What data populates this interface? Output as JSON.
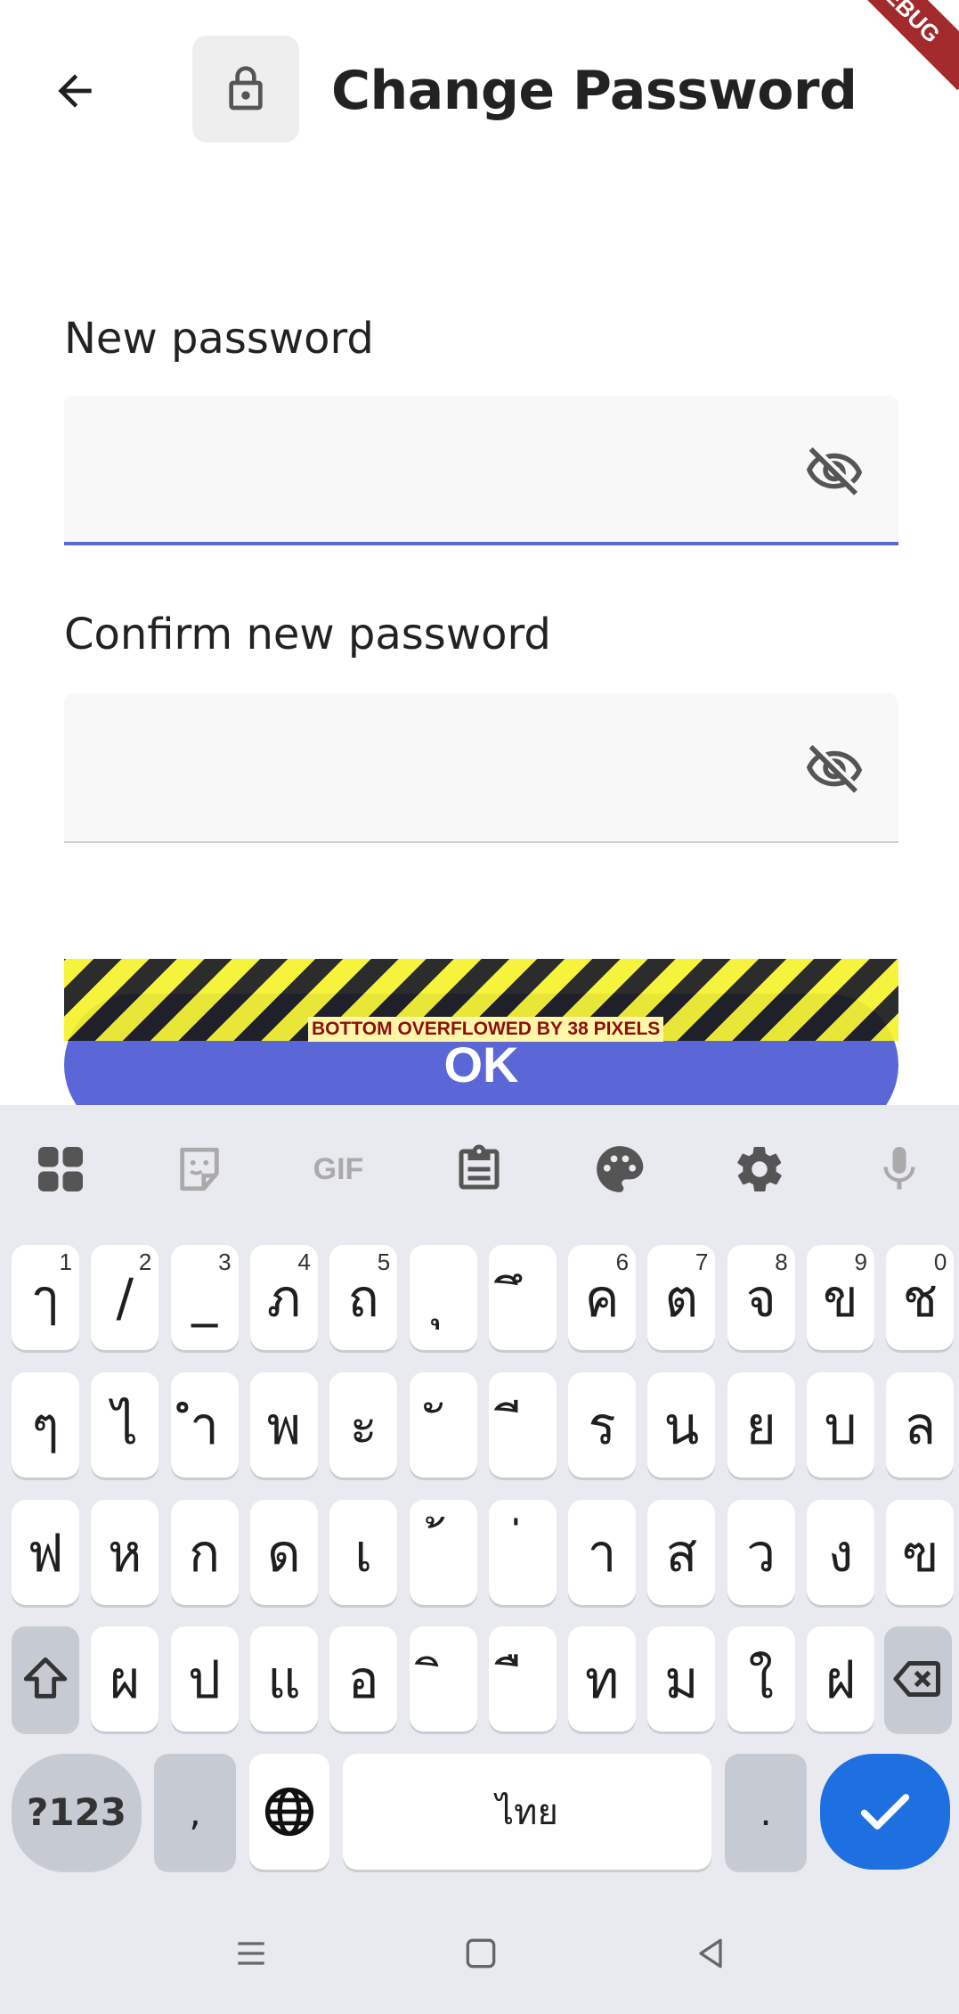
{
  "app_bar": {
    "title": "Change Password",
    "back_icon": "arrow-left-icon",
    "lock_icon": "lock-icon",
    "debug_banner": "DEBUG"
  },
  "form": {
    "new_password": {
      "label": "New password",
      "value": "",
      "visibility_icon": "eye-off-icon",
      "focused": true
    },
    "confirm_password": {
      "label": "Confirm new password",
      "value": "",
      "visibility_icon": "eye-off-icon",
      "focused": false
    },
    "overflow_warning": "BOTTOM OVERFLOWED BY 38 PIXELS",
    "ok_label": "OK"
  },
  "colors": {
    "accent": "#5b67d6",
    "keyboard_bg": "#e8eaef",
    "enter_key": "#1e6fe0"
  },
  "keyboard": {
    "toolbar": [
      "apps-grid-icon",
      "sticker-icon",
      "gif-icon",
      "clipboard-icon",
      "palette-icon",
      "settings-icon",
      "mic-icon"
    ],
    "gif_label": "GIF",
    "row1": [
      {
        "k": "ๅ",
        "h": "1"
      },
      {
        "k": "/",
        "h": "2"
      },
      {
        "k": "_",
        "h": "3"
      },
      {
        "k": "ภ",
        "h": "4"
      },
      {
        "k": "ถ",
        "h": "5"
      },
      {
        "k": "ุ",
        "h": ""
      },
      {
        "k": "ึ",
        "h": ""
      },
      {
        "k": "ค",
        "h": "6"
      },
      {
        "k": "ต",
        "h": "7"
      },
      {
        "k": "จ",
        "h": "8"
      },
      {
        "k": "ข",
        "h": "9"
      },
      {
        "k": "ช",
        "h": "0"
      }
    ],
    "row2": [
      "ๆ",
      "ไ",
      "ำ",
      "พ",
      "ะ",
      "ั",
      "ี",
      "ร",
      "น",
      "ย",
      "บ",
      "ล"
    ],
    "row3": [
      "ฟ",
      "ห",
      "ก",
      "ด",
      "เ",
      "้",
      "่",
      "า",
      "ส",
      "ว",
      "ง",
      "ฃ"
    ],
    "row4": [
      "ผ",
      "ป",
      "แ",
      "อ",
      "ิ",
      "ื",
      "ท",
      "ม",
      "ใ",
      "ฝ"
    ],
    "shift_icon": "shift-icon",
    "backspace_icon": "backspace-icon",
    "symbols_label": "?123",
    "comma_label": ",",
    "globe_icon": "globe-icon",
    "space_label": "ไทย",
    "period_label": ".",
    "enter_icon": "check-icon"
  },
  "nav": [
    "recents-icon",
    "home-icon",
    "back-triangle-icon"
  ]
}
